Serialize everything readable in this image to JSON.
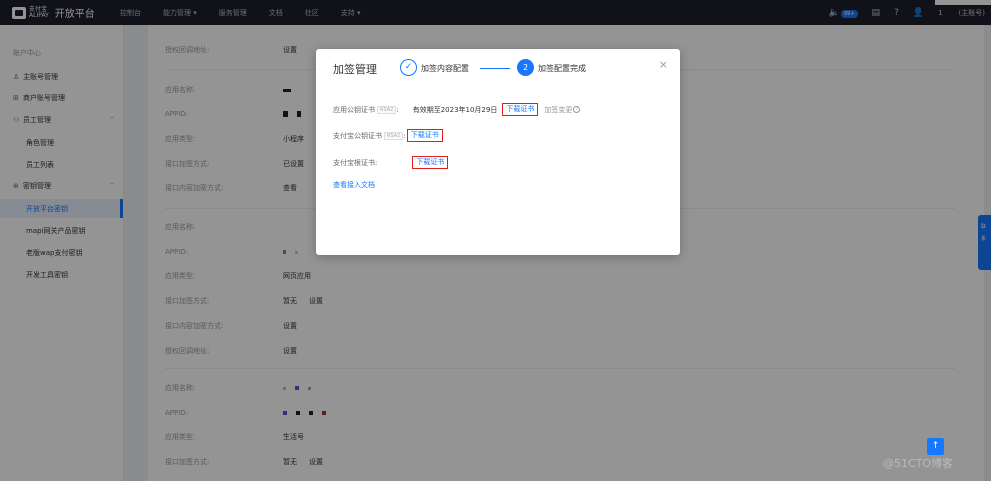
{
  "topnav": {
    "brand_small": "支付宝\nALIPAY",
    "brand_title": "开放平台",
    "items": [
      "控制台",
      "能力管理 ▾",
      "服务管理",
      "文档",
      "社区",
      "支持 ▾"
    ],
    "msg_badge": "99+",
    "user_name": "1",
    "role": "(主账号)"
  },
  "sidebar": {
    "header": "账户中心",
    "items": [
      {
        "label": "主账号管理",
        "icon": "user-icon"
      },
      {
        "label": "商户账号管理",
        "icon": "merchant-icon"
      },
      {
        "label": "员工管理",
        "icon": "staff-icon",
        "caret": "^"
      },
      {
        "label": "密钥管理",
        "icon": "key-icon",
        "caret": "^"
      }
    ],
    "staff_subs": [
      "角色管理",
      "员工列表"
    ],
    "key_subs": [
      "开放平台密钥",
      "mapi网关产品密钥",
      "老版wap支付密钥",
      "开发工具密钥"
    ]
  },
  "card1": {
    "row_top": {
      "label": "授权回调地址:",
      "link": "设置"
    }
  },
  "card2": {
    "rows": [
      {
        "label": "应用名称:",
        "value": ""
      },
      {
        "label": "APPID:",
        "value": ""
      },
      {
        "label": "应用类型:",
        "value": "小程序"
      },
      {
        "label": "接口加签方式:",
        "value": "已设置"
      },
      {
        "label": "接口内容加密方式:",
        "link": "查看"
      }
    ]
  },
  "card3": {
    "rows": [
      {
        "label": "应用名称:",
        "value": ""
      },
      {
        "label": "APPID:",
        "value": ""
      },
      {
        "label": "应用类型:",
        "value": "网页应用"
      },
      {
        "label": "接口加签方式:",
        "value": "暂无",
        "link": "设置"
      },
      {
        "label": "接口内容加密方式:",
        "link": "设置"
      },
      {
        "label": "授权回调地址:",
        "link": "设置"
      }
    ]
  },
  "card4": {
    "rows": [
      {
        "label": "应用名称:",
        "value": ""
      },
      {
        "label": "APPID:",
        "value": ""
      },
      {
        "label": "应用类型:",
        "value": "生活号"
      },
      {
        "label": "接口加签方式:",
        "value": "暂无",
        "link": "设置"
      }
    ]
  },
  "modal": {
    "title": "加签管理",
    "step1": "加签内容配置",
    "step2_num": "2",
    "step2": "加签配置完成",
    "close": "×",
    "app_cert_label": "应用公钥证书",
    "tag": "RSA2",
    "colon": ":",
    "valid_text": "有效期至2023年10月29日",
    "download": "下载证书",
    "change": "加签变更",
    "alipay_pub_cert_label": "支付宝公钥证书",
    "alipay_root_cert_label": "支付宝根证书:",
    "doc_link": "查看接入文档"
  },
  "float": {
    "line1": "联",
    "line2": "系"
  },
  "backtop_glyph": "↑",
  "watermark": "@51CTO博客",
  "colors": {
    "primary": "#1677ff",
    "topnav": "#1c1e2b",
    "highlight": "#e02020"
  }
}
